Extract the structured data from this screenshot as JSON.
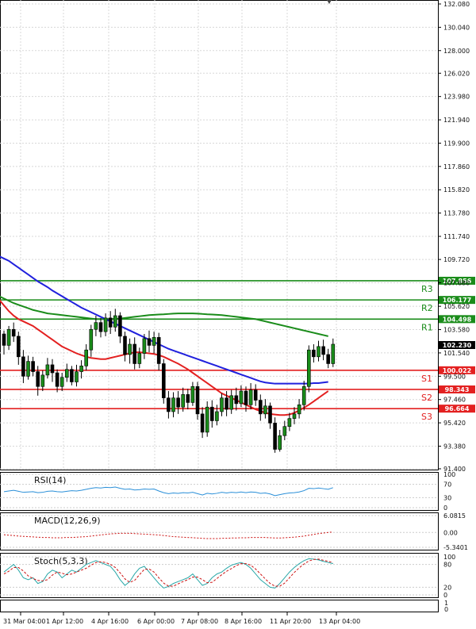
{
  "chart_data": {
    "type": "candlestick",
    "price_axis": {
      "ticks": [
        "132.080",
        "130.040",
        "128.000",
        "126.020",
        "123.980",
        "121.940",
        "119.900",
        "117.860",
        "115.820",
        "113.780",
        "111.740",
        "109.720",
        "107.680",
        "105.620",
        "103.580",
        "101.540",
        "99.500",
        "97.460",
        "95.420",
        "93.380",
        "91.400"
      ],
      "ylim": [
        91.4,
        132.08
      ]
    },
    "time_axis": {
      "labels": [
        "31 Mar 04:00",
        "1 Apr 12:00",
        "4 Apr 16:00",
        "6 Apr 00:00",
        "7 Apr 08:00",
        "8 Apr 16:00",
        "11 Apr 20:00",
        "13 Apr 04:00"
      ]
    },
    "levels": [
      {
        "name": "R3",
        "value": "107.856",
        "color": "#1a8c1a"
      },
      {
        "name": "R2",
        "value": "106.177",
        "color": "#1a8c1a"
      },
      {
        "name": "R1",
        "value": "104.498",
        "color": "#1a8c1a"
      },
      {
        "name": "S1",
        "value": "100.022",
        "color": "#e32020"
      },
      {
        "name": "S2",
        "value": "98.343",
        "color": "#e32020"
      },
      {
        "name": "S3",
        "value": "96.664",
        "color": "#e32020"
      }
    ],
    "current_price": "102.230",
    "candles": [
      [
        103.2,
        102.2,
        103.5,
        101.4
      ],
      [
        102.2,
        103.6,
        103.9,
        101.8
      ],
      [
        103.6,
        103.0,
        104.2,
        102.5
      ],
      [
        103.0,
        101.2,
        103.4,
        100.5
      ],
      [
        101.2,
        99.5,
        101.8,
        98.9
      ],
      [
        99.5,
        100.8,
        101.3,
        99.2
      ],
      [
        100.8,
        99.9,
        101.2,
        99.5
      ],
      [
        99.9,
        98.6,
        100.4,
        97.8
      ],
      [
        98.6,
        99.6,
        100.0,
        98.2
      ],
      [
        99.6,
        100.5,
        101.1,
        99.3
      ],
      [
        100.5,
        99.8,
        101.0,
        99.0
      ],
      [
        99.8,
        98.6,
        100.1,
        98.1
      ],
      [
        98.6,
        99.4,
        99.8,
        98.2
      ],
      [
        99.4,
        100.1,
        100.6,
        99.0
      ],
      [
        100.1,
        99.0,
        100.4,
        98.7
      ],
      [
        99.0,
        99.9,
        100.5,
        98.6
      ],
      [
        99.9,
        100.4,
        100.9,
        99.3
      ],
      [
        100.4,
        101.8,
        102.3,
        100.0
      ],
      [
        101.8,
        103.6,
        104.0,
        101.2
      ],
      [
        103.6,
        104.2,
        104.8,
        103.0
      ],
      [
        104.2,
        103.4,
        104.6,
        102.9
      ],
      [
        103.4,
        104.6,
        105.0,
        103.0
      ],
      [
        104.6,
        103.8,
        105.2,
        103.2
      ],
      [
        103.8,
        104.8,
        105.4,
        103.4
      ],
      [
        104.8,
        103.0,
        105.1,
        102.4
      ],
      [
        103.0,
        101.4,
        103.4,
        100.8
      ],
      [
        101.4,
        102.3,
        102.8,
        100.6
      ],
      [
        102.3,
        100.6,
        102.9,
        100.1
      ],
      [
        100.6,
        101.5,
        102.0,
        100.2
      ],
      [
        101.5,
        102.8,
        103.2,
        101.0
      ],
      [
        102.8,
        102.2,
        103.5,
        101.6
      ],
      [
        102.2,
        102.9,
        103.4,
        101.5
      ],
      [
        102.9,
        100.6,
        103.3,
        100.0
      ],
      [
        100.6,
        97.6,
        101.0,
        97.1
      ],
      [
        97.6,
        96.4,
        98.2,
        95.8
      ],
      [
        96.4,
        97.6,
        98.1,
        95.9
      ],
      [
        97.6,
        96.8,
        98.2,
        96.2
      ],
      [
        96.8,
        97.9,
        98.5,
        96.4
      ],
      [
        97.9,
        97.2,
        98.4,
        96.6
      ],
      [
        97.2,
        98.6,
        99.0,
        96.9
      ],
      [
        98.6,
        96.2,
        99.0,
        95.7
      ],
      [
        96.2,
        94.6,
        96.8,
        94.1
      ],
      [
        94.6,
        96.8,
        97.3,
        94.2
      ],
      [
        96.8,
        95.6,
        97.4,
        95.0
      ],
      [
        95.6,
        96.4,
        97.0,
        95.2
      ],
      [
        96.4,
        97.6,
        98.0,
        96.0
      ],
      [
        97.6,
        96.6,
        98.2,
        96.0
      ],
      [
        96.6,
        97.8,
        98.3,
        96.2
      ],
      [
        97.8,
        97.1,
        98.5,
        96.5
      ],
      [
        97.1,
        98.2,
        98.7,
        96.8
      ],
      [
        98.2,
        97.0,
        98.6,
        96.4
      ],
      [
        97.0,
        98.3,
        98.9,
        96.6
      ],
      [
        98.3,
        97.4,
        98.8,
        96.9
      ],
      [
        97.4,
        96.2,
        97.9,
        95.6
      ],
      [
        96.2,
        96.9,
        97.5,
        95.8
      ],
      [
        96.9,
        95.4,
        97.2,
        94.9
      ],
      [
        95.4,
        93.1,
        95.9,
        92.8
      ],
      [
        93.1,
        94.3,
        94.8,
        92.9
      ],
      [
        94.3,
        95.1,
        95.6,
        93.9
      ],
      [
        95.1,
        95.8,
        96.3,
        94.7
      ],
      [
        95.8,
        96.2,
        96.8,
        95.3
      ],
      [
        96.2,
        97.0,
        97.5,
        95.8
      ],
      [
        97.0,
        98.6,
        99.1,
        96.5
      ],
      [
        98.6,
        101.8,
        102.2,
        98.1
      ],
      [
        101.8,
        101.2,
        102.3,
        100.7
      ],
      [
        101.2,
        102.1,
        102.6,
        100.8
      ],
      [
        102.1,
        101.4,
        102.7,
        100.9
      ],
      [
        101.4,
        100.6,
        101.9,
        100.2
      ],
      [
        100.6,
        102.3,
        102.8,
        100.3
      ]
    ],
    "series": [
      {
        "name": "MA50",
        "color": "#1a8c1a",
        "values": [
          106.5,
          106.3,
          106.1,
          105.9,
          105.75,
          105.6,
          105.45,
          105.3,
          105.2,
          105.1,
          105.0,
          104.95,
          104.9,
          104.85,
          104.8,
          104.75,
          104.7,
          104.65,
          104.6,
          104.55,
          104.5,
          104.5,
          104.5,
          104.5,
          104.52,
          104.55,
          104.6,
          104.65,
          104.7,
          104.75,
          104.8,
          104.85,
          104.88,
          104.9,
          104.92,
          104.95,
          104.98,
          105.0,
          105.0,
          105.0,
          105.0,
          104.98,
          104.95,
          104.92,
          104.9,
          104.88,
          104.85,
          104.8,
          104.75,
          104.7,
          104.65,
          104.6,
          104.55,
          104.5,
          104.4,
          104.3,
          104.2,
          104.1,
          104.0,
          103.9,
          103.8,
          103.7,
          103.6,
          103.5,
          103.4,
          103.3,
          103.2,
          103.1,
          103.0
        ]
      },
      {
        "name": "MA20",
        "color": "#2020dd",
        "values": [
          110.0,
          109.8,
          109.6,
          109.3,
          109.0,
          108.7,
          108.4,
          108.1,
          107.8,
          107.55,
          107.3,
          107.0,
          106.75,
          106.5,
          106.25,
          106.0,
          105.75,
          105.5,
          105.3,
          105.1,
          104.9,
          104.7,
          104.5,
          104.3,
          104.1,
          103.9,
          103.7,
          103.5,
          103.3,
          103.1,
          102.9,
          102.7,
          102.5,
          102.3,
          102.1,
          101.9,
          101.75,
          101.6,
          101.45,
          101.3,
          101.15,
          101.0,
          100.85,
          100.7,
          100.55,
          100.4,
          100.25,
          100.1,
          99.95,
          99.8,
          99.65,
          99.5,
          99.35,
          99.2,
          99.05,
          98.95,
          98.9,
          98.85,
          98.85,
          98.85,
          98.85,
          98.85,
          98.85,
          98.85,
          98.85,
          98.9,
          98.9,
          98.95,
          99.0
        ]
      },
      {
        "name": "MA10",
        "color": "#e32020",
        "values": [
          106.2,
          105.7,
          105.2,
          104.8,
          104.5,
          104.3,
          104.1,
          103.9,
          103.6,
          103.3,
          103.0,
          102.7,
          102.4,
          102.1,
          101.9,
          101.7,
          101.5,
          101.35,
          101.2,
          101.1,
          101.05,
          101.0,
          101.0,
          101.1,
          101.2,
          101.3,
          101.4,
          101.5,
          101.6,
          101.6,
          101.55,
          101.5,
          101.45,
          101.35,
          101.2,
          101.0,
          100.8,
          100.6,
          100.35,
          100.1,
          99.8,
          99.5,
          99.2,
          98.9,
          98.6,
          98.3,
          98.0,
          97.8,
          97.6,
          97.4,
          97.2,
          97.0,
          96.8,
          96.6,
          96.45,
          96.3,
          96.2,
          96.15,
          96.1,
          96.1,
          96.15,
          96.3,
          96.5,
          96.75,
          97.0,
          97.3,
          97.6,
          97.9,
          98.2
        ]
      }
    ],
    "indicators": [
      {
        "name": "RSI(14)",
        "ticks": [
          "100",
          "70",
          "30",
          "0"
        ],
        "color": "#2a8fd8",
        "values": [
          48,
          50,
          52,
          49,
          46,
          47,
          48,
          45,
          46,
          49,
          50,
          48,
          47,
          49,
          51,
          50,
          52,
          55,
          58,
          60,
          59,
          61,
          60,
          62,
          58,
          55,
          56,
          53,
          54,
          56,
          55,
          56,
          50,
          45,
          42,
          44,
          43,
          45,
          44,
          46,
          42,
          38,
          43,
          41,
          43,
          46,
          44,
          46,
          45,
          47,
          45,
          47,
          46,
          43,
          44,
          41,
          36,
          39,
          42,
          44,
          45,
          47,
          51,
          58,
          57,
          59,
          57,
          55,
          60
        ]
      },
      {
        "name": "MACD(12,26,9)",
        "ticks": [
          "6.0815",
          "0.00",
          "-5.3401"
        ],
        "color": "#cc1111",
        "values": [
          -0.8,
          -1.0,
          -1.1,
          -1.3,
          -1.4,
          -1.5,
          -1.6,
          -1.7,
          -1.8,
          -1.8,
          -1.9,
          -1.9,
          -1.9,
          -1.8,
          -1.8,
          -1.7,
          -1.6,
          -1.5,
          -1.3,
          -1.1,
          -0.9,
          -0.7,
          -0.5,
          -0.4,
          -0.3,
          -0.3,
          -0.3,
          -0.4,
          -0.5,
          -0.6,
          -0.7,
          -0.8,
          -0.9,
          -1.1,
          -1.3,
          -1.5,
          -1.6,
          -1.7,
          -1.8,
          -1.9,
          -2.0,
          -2.1,
          -2.2,
          -2.2,
          -2.2,
          -2.1,
          -2.1,
          -2.0,
          -2.0,
          -1.9,
          -1.9,
          -1.8,
          -1.8,
          -1.8,
          -1.8,
          -1.9,
          -2.0,
          -2.0,
          -1.9,
          -1.8,
          -1.7,
          -1.5,
          -1.3,
          -1.0,
          -0.7,
          -0.4,
          -0.2,
          0.0,
          0.2
        ]
      },
      {
        "name": "Stoch(5,3,3)",
        "ticks": [
          "100",
          "80",
          "20",
          "0"
        ],
        "colors": [
          "#2aa8a8",
          "#cc1111"
        ],
        "k": [
          60,
          70,
          80,
          65,
          45,
          40,
          45,
          30,
          35,
          55,
          65,
          60,
          45,
          55,
          65,
          60,
          70,
          80,
          85,
          90,
          85,
          80,
          75,
          60,
          40,
          25,
          35,
          55,
          70,
          75,
          60,
          45,
          30,
          18,
          22,
          30,
          35,
          40,
          45,
          55,
          40,
          25,
          30,
          45,
          55,
          60,
          70,
          78,
          82,
          85,
          80,
          70,
          55,
          40,
          30,
          20,
          18,
          30,
          45,
          60,
          72,
          82,
          90,
          95,
          94,
          92,
          88,
          85,
          82
        ],
        "d": [
          55,
          62,
          72,
          72,
          63,
          50,
          43,
          38,
          37,
          40,
          52,
          60,
          57,
          53,
          55,
          60,
          65,
          70,
          78,
          85,
          87,
          85,
          80,
          72,
          58,
          42,
          33,
          38,
          53,
          67,
          68,
          60,
          45,
          31,
          23,
          23,
          29,
          35,
          40,
          47,
          47,
          40,
          32,
          33,
          43,
          53,
          62,
          69,
          77,
          82,
          82,
          78,
          68,
          55,
          42,
          30,
          23,
          23,
          31,
          45,
          59,
          71,
          81,
          89,
          93,
          94,
          91,
          88,
          85
        ]
      }
    ]
  }
}
